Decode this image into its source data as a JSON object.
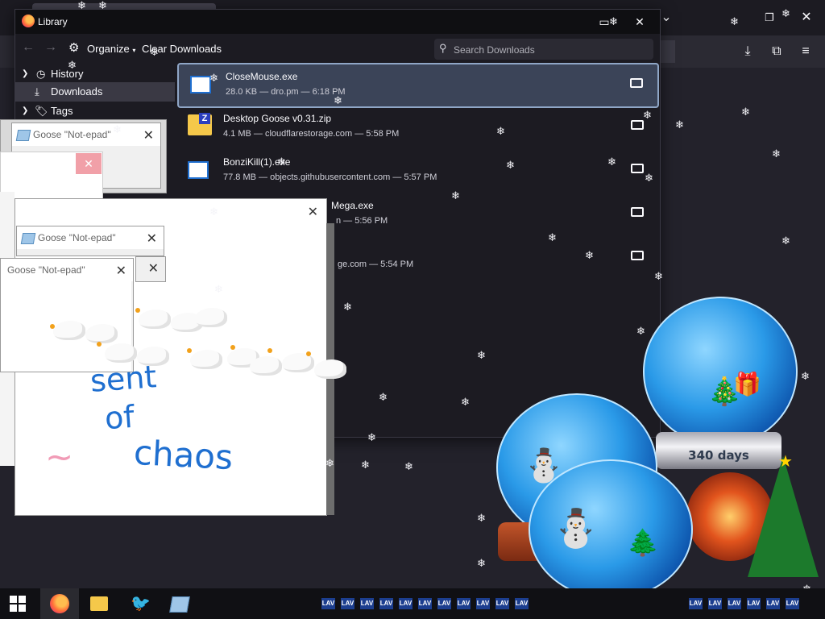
{
  "library": {
    "title": "Library",
    "organize_label": "Organize",
    "clear_downloads_label": "Clear Downloads",
    "search_placeholder": "Search Downloads",
    "sidebar": [
      {
        "label": "History",
        "expandable": true
      },
      {
        "label": "Downloads",
        "selected": true
      },
      {
        "label": "Tags",
        "expandable": true
      }
    ],
    "downloads": [
      {
        "name": "CloseMouse.exe",
        "meta": "28.0 KB — dro.pm — 6:18 PM",
        "type": "exe",
        "selected": true
      },
      {
        "name": "Desktop Goose v0.31.zip",
        "meta": "4.1 MB — cloudflarestorage.com — 5:58 PM",
        "type": "zip"
      },
      {
        "name": "BonziKill(1).exe",
        "meta": "77.8 MB — objects.githubusercontent.com — 5:57 PM",
        "type": "exe"
      },
      {
        "name": "Mega.exe",
        "meta": "n — 5:56 PM",
        "type": "exe"
      },
      {
        "name": "",
        "meta": "ge.com — 5:54 PM",
        "type": "exe"
      }
    ]
  },
  "notepads": [
    {
      "title": "Goose \"Not-epad\""
    },
    {
      "title": "Goose \"Not-epad\""
    },
    {
      "title": "Goose \"Not-epad\""
    }
  ],
  "drawing_text": [
    "sent",
    "of",
    "chaos",
    "~"
  ],
  "globes": {
    "days_label": "340 days"
  },
  "taskbar": {
    "tray_label": "LAV"
  },
  "colors": {
    "accent_blue": "#0a84ff",
    "drawing_blue": "#1f6fd0",
    "drawing_pink": "#f19bb6"
  }
}
